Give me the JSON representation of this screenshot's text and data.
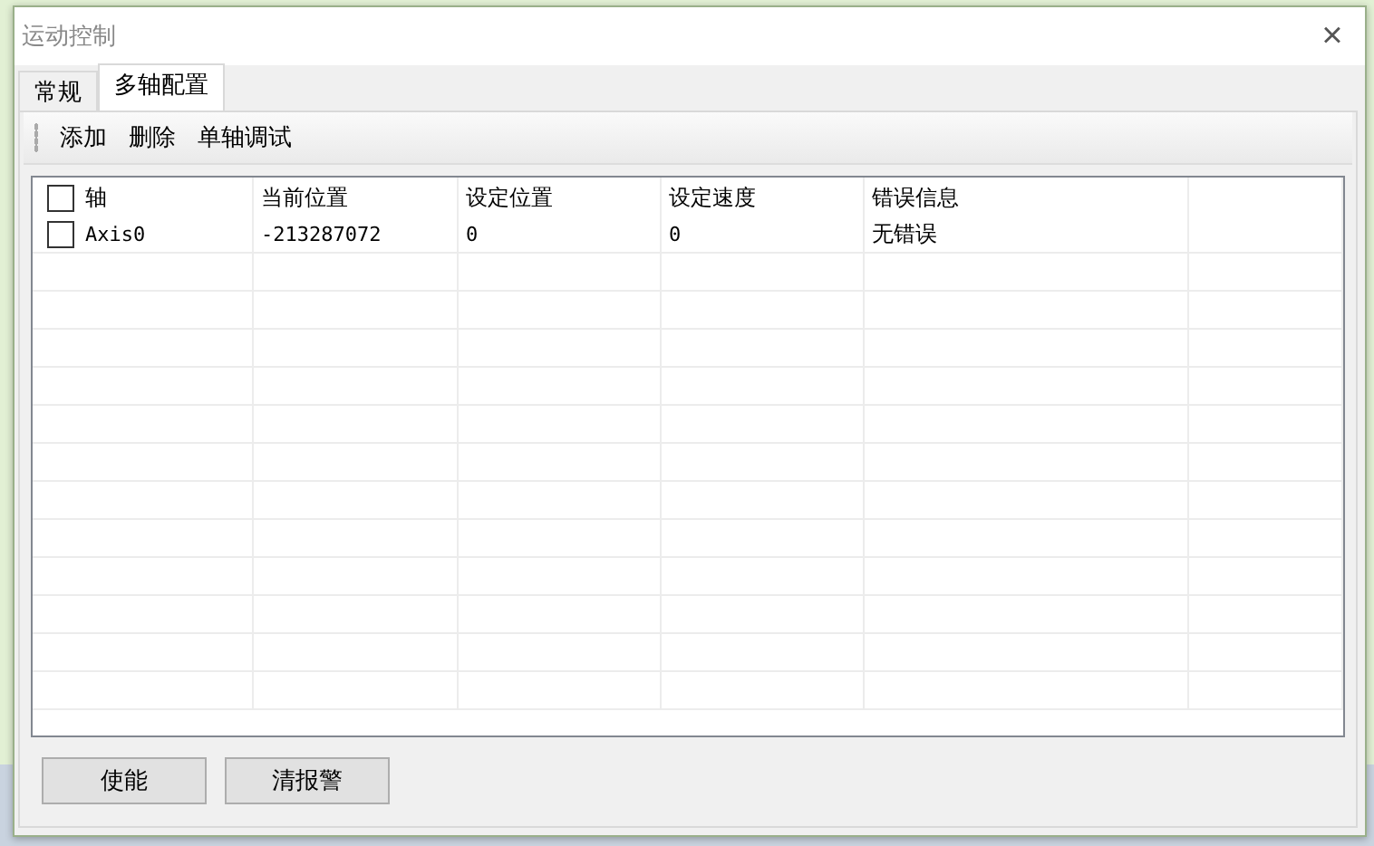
{
  "window": {
    "title": "运动控制",
    "close": "×"
  },
  "tabs": [
    {
      "label": "常规",
      "selected": false
    },
    {
      "label": "多轴配置",
      "selected": true
    }
  ],
  "toolbar": [
    "添加",
    "删除",
    "单轴调试"
  ],
  "table": {
    "select_all": {
      "checked": false
    },
    "columns": [
      "轴",
      "当前位置",
      "设定位置",
      "设定速度",
      "错误信息"
    ],
    "rows": [
      {
        "checked": false,
        "cells": [
          "Axis0",
          "-213287072",
          "0",
          "0",
          "无错误"
        ]
      }
    ]
  },
  "buttons": [
    "使能",
    "清报警"
  ]
}
